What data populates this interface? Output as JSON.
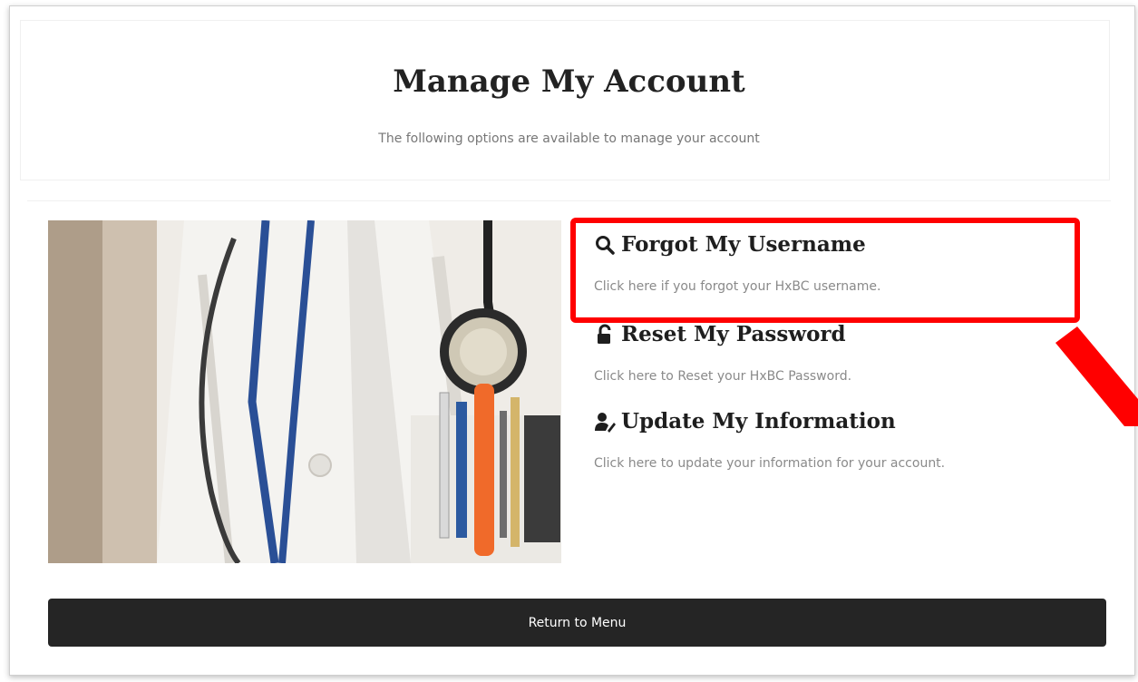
{
  "header": {
    "title": "Manage My Account",
    "subtitle": "The following options are available to manage your account"
  },
  "options": [
    {
      "title": "Forgot My Username",
      "description": "Click here if you forgot your HxBC username.",
      "icon": "search-icon"
    },
    {
      "title": "Reset My Password",
      "description": "Click here to Reset your HxBC Password.",
      "icon": "unlock-icon"
    },
    {
      "title": "Update My Information",
      "description": "Click here to update your information for your account.",
      "icon": "user-edit-icon"
    }
  ],
  "footer": {
    "return_label": "Return to Menu"
  },
  "annotation": {
    "highlight_color": "#ff0000"
  },
  "colors": {
    "button_bg": "#252525",
    "title_text": "#222222",
    "desc_text": "#8a8a8a"
  }
}
